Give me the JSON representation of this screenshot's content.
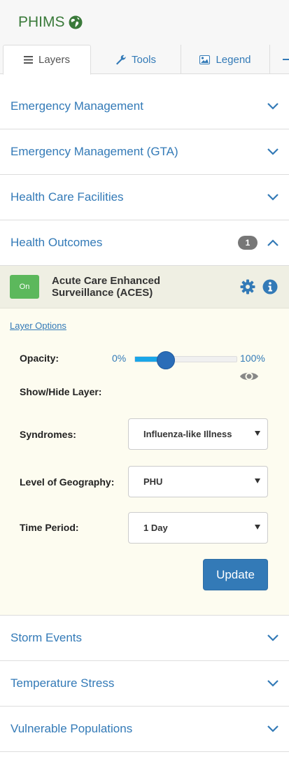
{
  "brand": {
    "title": "PHIMS"
  },
  "tabs": [
    {
      "label": "Layers",
      "icon": "list-icon"
    },
    {
      "label": "Tools",
      "icon": "wrench-icon"
    },
    {
      "label": "Legend",
      "icon": "image-icon"
    }
  ],
  "accordion_top": [
    {
      "label": "Emergency Management"
    },
    {
      "label": "Emergency Management (GTA)"
    },
    {
      "label": "Health Care Facilities"
    }
  ],
  "health_outcomes": {
    "label": "Health Outcomes",
    "badge": "1",
    "layer": {
      "toggle_label": "On",
      "name": "Acute Care Enhanced Surveillance (ACES)"
    },
    "options": {
      "link": "Layer Options",
      "opacity_label": "Opacity:",
      "opacity_min": "0%",
      "opacity_max": "100%",
      "opacity_value_percent": 30,
      "show_hide_label": "Show/Hide Layer:",
      "syndromes_label": "Syndromes:",
      "syndromes_value": "Influenza-like Illness",
      "geography_label": "Level of Geography:",
      "geography_value": "PHU",
      "time_label": "Time Period:",
      "time_value": "1 Day",
      "update_label": "Update"
    }
  },
  "accordion_bottom": [
    {
      "label": "Storm Events"
    },
    {
      "label": "Temperature Stress"
    },
    {
      "label": "Vulnerable Populations"
    }
  ],
  "colors": {
    "link": "#337ab7",
    "on_green": "#5cb85c",
    "brand_green": "#3a7a3a"
  }
}
